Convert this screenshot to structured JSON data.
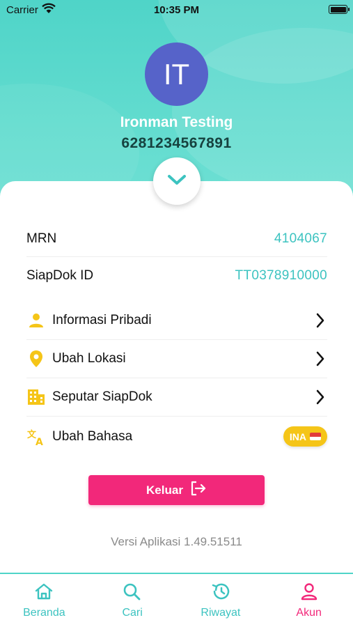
{
  "status_bar": {
    "carrier": "Carrier",
    "time": "10:35 PM"
  },
  "profile": {
    "initials": "IT",
    "name": "Ironman Testing",
    "phone": "6281234567891"
  },
  "info": {
    "mrn_label": "MRN",
    "mrn_value": "4104067",
    "siapdok_label": "SiapDok ID",
    "siapdok_value": "TT0378910000"
  },
  "menu": {
    "personal_info": "Informasi Pribadi",
    "change_location": "Ubah Lokasi",
    "about": "Seputar SiapDok",
    "change_language": "Ubah Bahasa",
    "language_badge": "INA"
  },
  "logout_label": "Keluar",
  "version": "Versi Aplikasi 1.49.51511",
  "tabs": [
    {
      "label": "Beranda",
      "icon": "home-icon"
    },
    {
      "label": "Cari",
      "icon": "search-icon"
    },
    {
      "label": "Riwayat",
      "icon": "history-icon"
    },
    {
      "label": "Akun",
      "icon": "user-icon"
    }
  ],
  "colors": {
    "header": "#4fd4c8",
    "accent_teal": "#3cc3c0",
    "avatar": "#5663c9",
    "logout": "#f2287a",
    "icon_yellow": "#f5c518",
    "active_tab": "#f2287a"
  }
}
